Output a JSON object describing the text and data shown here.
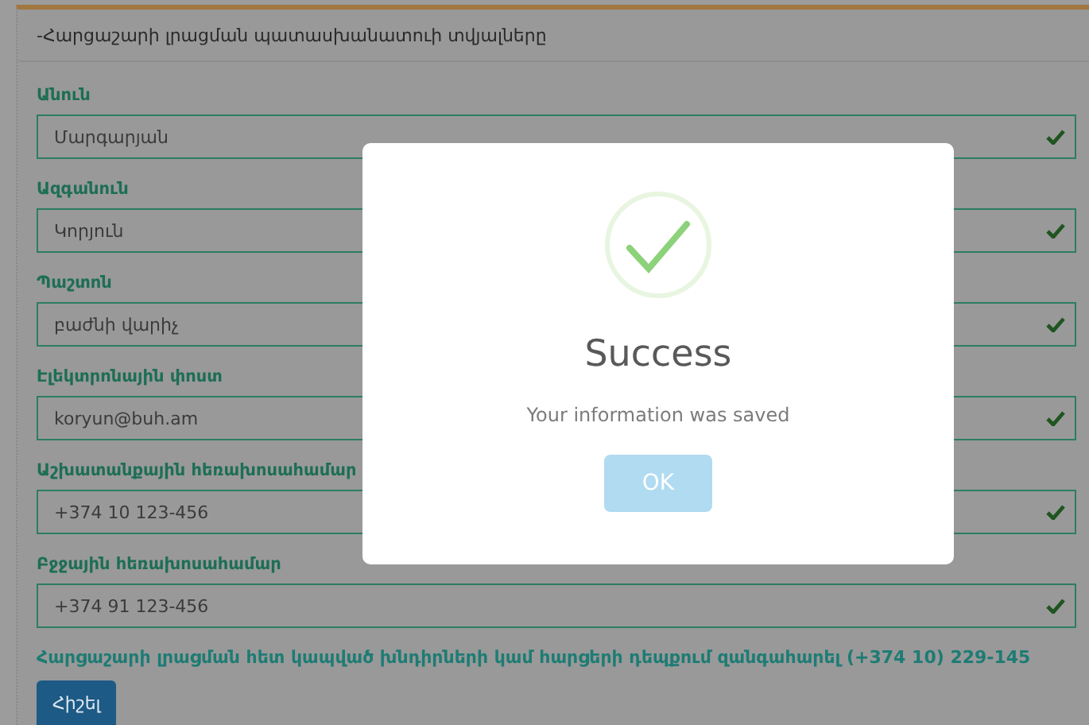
{
  "panel": {
    "title": "-Հարցաշարի լրացման պատասխանատուի տվյալները"
  },
  "fields": [
    {
      "label": "Անուն",
      "value": "Մարգարյան",
      "valid": true
    },
    {
      "label": "Ազգանուն",
      "value": "Կորյուն",
      "valid": true
    },
    {
      "label": "Պաշտոն",
      "value": "բաժնի վարիչ",
      "valid": true
    },
    {
      "label": "Էլեկտրոնային փոստ",
      "value": "koryun@buh.am",
      "valid": true
    },
    {
      "label": "Աշխատանքային հեռախոսահամար",
      "value": "+374 10 123-456",
      "valid": true
    },
    {
      "label": "Բջջային հեռախոսահամար",
      "value": "+374 91 123-456",
      "valid": true
    }
  ],
  "help_text": "Հարցաշարի լրացման հետ կապված խնդիրների կամ հարցերի դեպքում զանգահարել (+374 10) 229-145",
  "save_button": "Հիշել",
  "dialog": {
    "title": "Success",
    "message": "Your information was saved",
    "button": "OK"
  }
}
